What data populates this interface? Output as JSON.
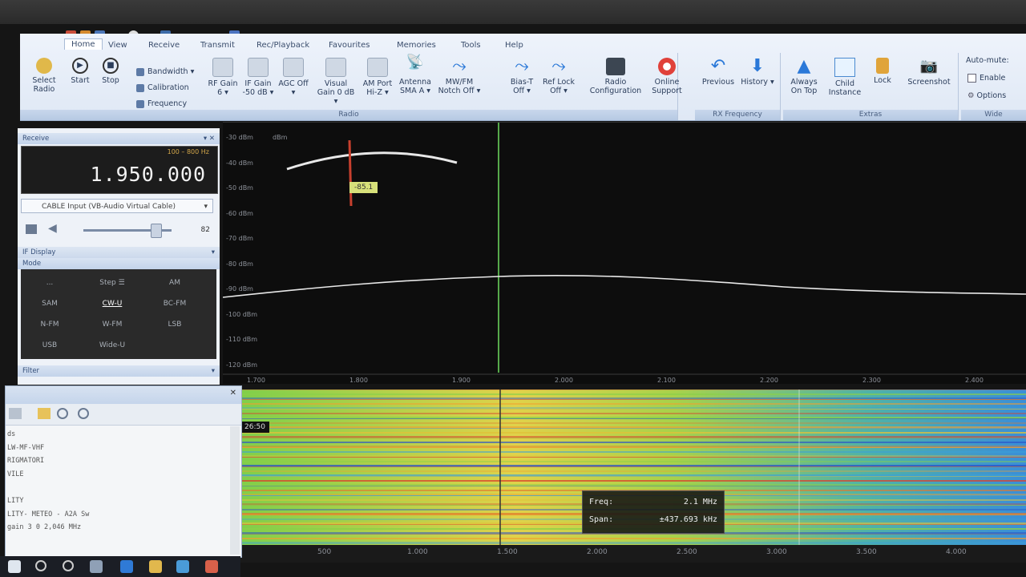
{
  "ribbon": {
    "menu": [
      "Home",
      "View",
      "Receive",
      "Transmit",
      "Rec/Playback",
      "Favourites",
      "Memories",
      "Tools",
      "Help"
    ],
    "active_menu": "Home",
    "select_radio": "Select Radio",
    "start": "Start",
    "stop": "Stop",
    "bandwidth": "Bandwidth",
    "calibration": "Calibration",
    "frequency": "Frequency",
    "rf_gain": "RF Gain 6",
    "if_gain": "IF Gain -50 dB",
    "agc": "AGC Off",
    "visual_gain": "Visual Gain 0 dB",
    "am_port": "AM Port Hi-Z",
    "antenna": "Antenna SMA A",
    "notch": "MW/FM Notch Off",
    "bias_t": "Bias-T Off",
    "ref_lock": "Ref Lock Off",
    "radio_config": "Radio Configuration",
    "online_support": "Online Support",
    "radio_group": "Radio",
    "previous": "Previous",
    "history": "History",
    "rx_frequency_group": "RX Frequency",
    "always_on_top": "Always On Top",
    "child_instance": "Child Instance",
    "lock": "Lock",
    "screenshot": "Screenshot",
    "extras_group": "Extras",
    "auto_mute": "Auto-mute:",
    "enable": "Enable",
    "options": "Options",
    "wide_group": "Wide"
  },
  "left": {
    "receive_title": "Receive",
    "range": "100 – 800 Hz",
    "frequency": "1.950.000",
    "input_source": "CABLE Input (VB-Audio Virtual Cable)",
    "volume_value": "82",
    "volume_level": 0.82,
    "if_display": "IF Display",
    "mode_title": "Mode",
    "modes": [
      [
        "...",
        "Step ☰",
        "AM"
      ],
      [
        "SAM",
        "CW-U",
        "BC-FM"
      ],
      [
        "N-FM",
        "W-FM",
        "LSB"
      ],
      [
        "USB",
        "Wide-U",
        ""
      ]
    ],
    "active_mode": "CW-U",
    "filter_title": "Filter"
  },
  "spectrum": {
    "dbm_unit": "dBm",
    "dbm_labels": [
      "-30 dBm",
      "-40 dBm",
      "-50 dBm",
      "-60 dBm",
      "-70 dBm",
      "-80 dBm",
      "-90 dBm",
      "-100 dBm",
      "-110 dBm",
      "-120 dBm"
    ],
    "freq_labels": [
      "1.700",
      "1.800",
      "1.900",
      "2.000",
      "2.100",
      "2.200",
      "2.300",
      "2.400"
    ],
    "meter_value": "-85.1"
  },
  "waterfall": {
    "time": "26:50",
    "tooltip": {
      "freq_label": "Freq:",
      "freq_value": "2.1 MHz",
      "span_label": "Span:",
      "span_value": "±437.693 kHz"
    },
    "axis_labels": [
      "500",
      "1.000",
      "1.500",
      "2.000",
      "2.500",
      "3.000",
      "3.500",
      "4.000"
    ]
  },
  "log": {
    "lines": [
      "ds",
      "LW-MF-VHF",
      "RIGMATORI",
      "VILE",
      "",
      "LITY",
      "LITY-  METEO - A2A Sw",
      "gain 3 0 2,046 MHz"
    ]
  },
  "colors": {
    "ribbon_bg": "#e3ebf6",
    "spectrum_bg": "#0d0d0d",
    "trace": "#e8e8e8",
    "center_line": "#56a84a"
  }
}
